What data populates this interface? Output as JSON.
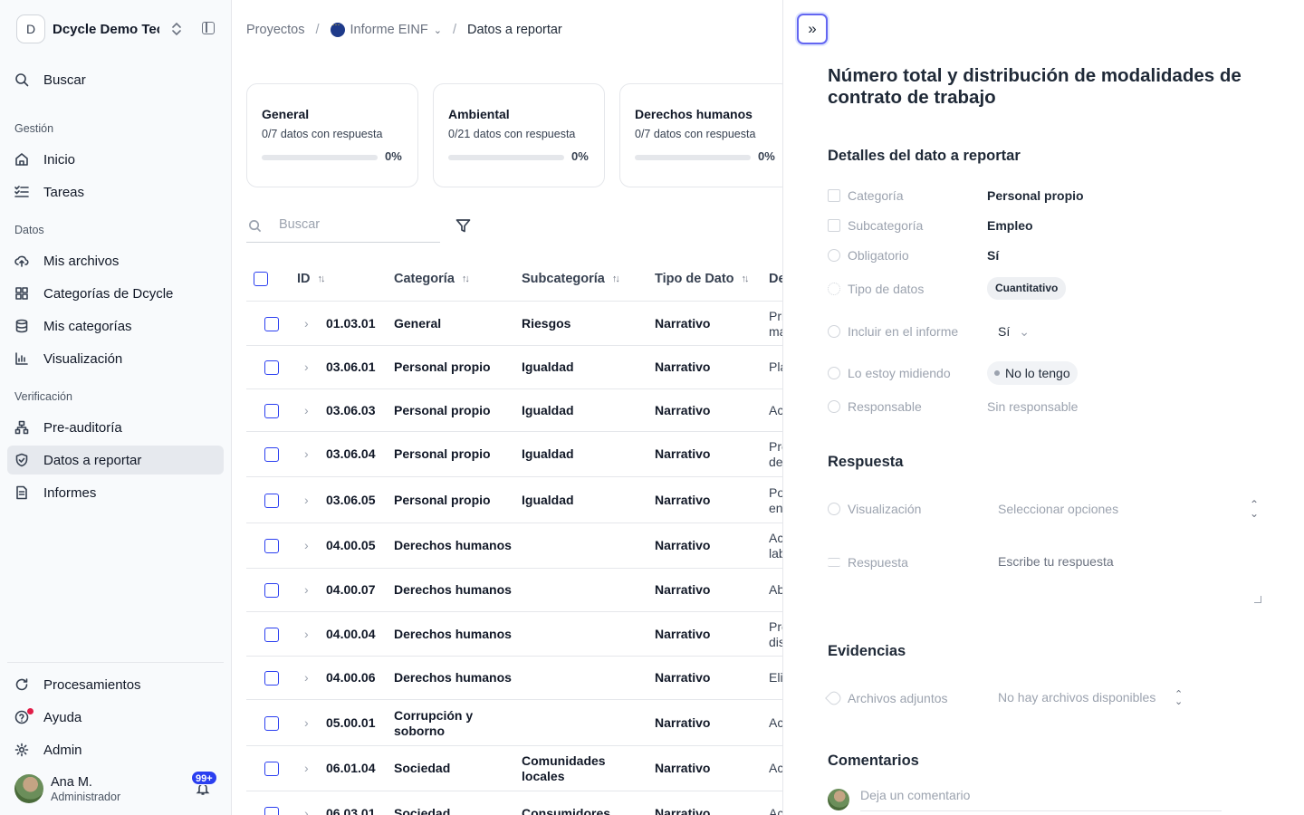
{
  "workspace": {
    "initial": "D",
    "name": "Dcycle Demo Tech"
  },
  "sidebar": {
    "search": "Buscar",
    "sections": {
      "gestion": "Gestión",
      "datos": "Datos",
      "verificacion": "Verificación"
    },
    "items": {
      "inicio": "Inicio",
      "tareas": "Tareas",
      "archivos": "Mis archivos",
      "cat_dcycle": "Categorías de Dcycle",
      "mis_cat": "Mis categorías",
      "visualizacion": "Visualización",
      "preaudit": "Pre-auditoría",
      "datos_reportar": "Datos a reportar",
      "informes": "Informes",
      "procesamientos": "Procesamientos",
      "ayuda": "Ayuda",
      "admin": "Admin"
    },
    "user": {
      "name": "Ana M.",
      "role": "Administrador",
      "notifications": "99+"
    }
  },
  "breadcrumb": {
    "projects": "Proyectos",
    "report": "Informe EINF",
    "current": "Datos a reportar"
  },
  "cards": [
    {
      "title": "General",
      "subtitle": "0/7 datos con respuesta",
      "percent": "0%",
      "progress": 0
    },
    {
      "title": "Ambiental",
      "subtitle": "0/21 datos con respuesta",
      "percent": "0%",
      "progress": 0
    },
    {
      "title": "Derechos humanos",
      "subtitle": "0/7 datos con respuesta",
      "percent": "0%",
      "progress": 0
    }
  ],
  "table": {
    "search_placeholder": "Buscar",
    "headers": {
      "id": "ID",
      "categoria": "Categoría",
      "subcategoria": "Subcategoría",
      "tipo": "Tipo de Dato",
      "desc": "De"
    },
    "rows": [
      {
        "id": "01.03.01",
        "cat": "General",
        "sub": "Riesgos",
        "tipo": "Narrativo",
        "d1": "Pri",
        "d2": "ma"
      },
      {
        "id": "03.06.01",
        "cat": "Personal propio",
        "sub": "Igualdad",
        "tipo": "Narrativo",
        "d1": "Pla",
        "d2": ""
      },
      {
        "id": "03.06.03",
        "cat": "Personal propio",
        "sub": "Igualdad",
        "tipo": "Narrativo",
        "d1": "Ac",
        "d2": ""
      },
      {
        "id": "03.06.04",
        "cat": "Personal propio",
        "sub": "Igualdad",
        "tipo": "Narrativo",
        "d1": "Pre",
        "d2": "de"
      },
      {
        "id": "03.06.05",
        "cat": "Personal propio",
        "sub": "Igualdad",
        "tipo": "Narrativo",
        "d1": "Po",
        "d2": "en"
      },
      {
        "id": "04.00.05",
        "cat": "Derechos humanos",
        "sub": "",
        "tipo": "Narrativo",
        "d1": "Ac",
        "d2": "lab"
      },
      {
        "id": "04.00.07",
        "cat": "Derechos humanos",
        "sub": "",
        "tipo": "Narrativo",
        "d1": "Ab",
        "d2": ""
      },
      {
        "id": "04.00.04",
        "cat": "Derechos humanos",
        "sub": "",
        "tipo": "Narrativo",
        "d1": "Pre",
        "d2": "dis"
      },
      {
        "id": "04.00.06",
        "cat": "Derechos humanos",
        "sub": "",
        "tipo": "Narrativo",
        "d1": "Eli",
        "d2": ""
      },
      {
        "id": "05.00.01",
        "cat": "Corrupción y",
        "cat2": "soborno",
        "sub": "",
        "tipo": "Narrativo",
        "d1": "Ac",
        "d2": ""
      },
      {
        "id": "06.01.04",
        "cat": "Sociedad",
        "sub": "Comunidades",
        "sub2": "locales",
        "tipo": "Narrativo",
        "d1": "Ac",
        "d2": ""
      },
      {
        "id": "06.03.01",
        "cat": "Sociedad",
        "sub": "Consumidores",
        "tipo": "Narrativo",
        "d1": "Ac",
        "d2": ""
      }
    ]
  },
  "panel": {
    "title": "Número total y distribución de modalidades de contrato de trabajo",
    "details_heading": "Detalles del dato a reportar",
    "labels": {
      "categoria": "Categoría",
      "subcategoria": "Subcategoría",
      "obligatorio": "Obligatorio",
      "tipo": "Tipo de datos",
      "incluir": "Incluir en el informe",
      "midiendo": "Lo estoy midiendo",
      "responsable": "Responsable"
    },
    "values": {
      "categoria": "Personal propio",
      "subcategoria": "Empleo",
      "obligatorio": "Sí",
      "tipo": "Cuantitativo",
      "incluir": "Sí",
      "midiendo": "No lo tengo",
      "responsable": "Sin responsable"
    },
    "respuesta_heading": "Respuesta",
    "visualizacion_label": "Visualización",
    "visualizacion_placeholder": "Seleccionar opciones",
    "respuesta_label": "Respuesta",
    "respuesta_placeholder": "Escribe tu respuesta",
    "evidencias_heading": "Evidencias",
    "adjuntos_label": "Archivos adjuntos",
    "adjuntos_value": "No hay archivos disponibles",
    "comentarios_heading": "Comentarios",
    "comment_placeholder": "Deja un comentario"
  }
}
